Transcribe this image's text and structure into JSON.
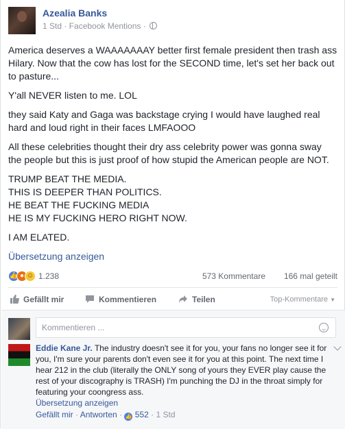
{
  "post": {
    "author": "Azealia Banks",
    "meta": "1 Std · Facebook Mentions ·",
    "paragraphs": [
      "America deserves a WAAAAAAAY better first female president then trash ass Hilary. Now that the cow has lost for the SECOND time, let's set her back out to pasture...",
      "Y'all NEVER listen to me. LOL",
      "they said Katy and Gaga was backstage crying I would have laughed real hard and loud right in their faces LMFAOOO",
      "All these celebrities thought their dry ass celebrity power was gonna sway the people but this is just proof of how stupid the American people are NOT."
    ],
    "caps_lines": [
      "TRUMP BEAT THE MEDIA.",
      "THIS IS DEEPER THAN POLITICS.",
      "HE BEAT THE FUCKING MEDIA",
      "HE IS MY FUCKING HERO RIGHT NOW."
    ],
    "last_paragraph": "I AM ELATED.",
    "translate_label": "Übersetzung anzeigen"
  },
  "stats": {
    "reaction_count": "1.238",
    "comments": "573 Kommentare",
    "shares": "166 mal geteilt"
  },
  "actions": {
    "like": "Gefällt mir",
    "comment": "Kommentieren",
    "share": "Teilen",
    "sort": "Top-Kommentare"
  },
  "comment_box": {
    "placeholder": "Kommentieren ..."
  },
  "reply": {
    "author": "Eddie Kane Jr.",
    "text": "The industry doesn't see it for you, your fans no longer see it for you, I'm sure your parents don't even see it for you at this point. The next time I hear 212 in the club (literally the ONLY song of yours they EVER play cause the rest of your discography is TRASH) I'm punching the DJ in the throat simply for featuring your coongress ass.",
    "translate_label": "Übersetzung anzeigen",
    "like_label": "Gefällt mir",
    "reply_label": "Antworten",
    "like_count": "552",
    "time": "1 Std"
  },
  "colors": {
    "link": "#365899",
    "muted": "#90949c",
    "like_blue": "#4c7fe6"
  }
}
